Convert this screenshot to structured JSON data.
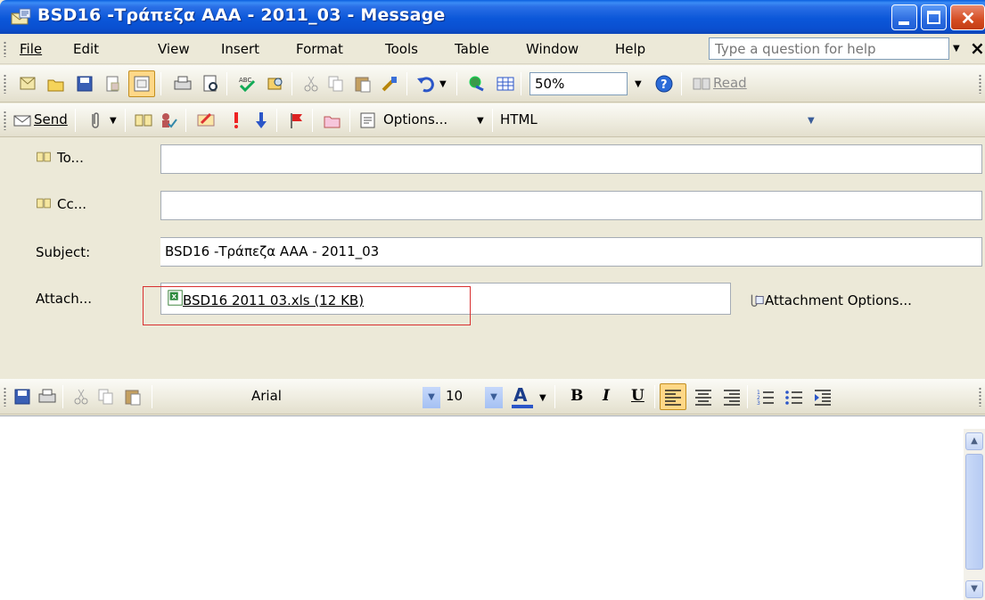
{
  "window": {
    "title": "BSD16 -Τράπεζα AAA - 2011_03 - Message"
  },
  "menu": {
    "items": [
      "File",
      "Edit",
      "View",
      "Insert",
      "Format",
      "Tools",
      "Table",
      "Window",
      "Help"
    ],
    "help_placeholder": "Type a question for help",
    "close_glyph": "×"
  },
  "standard_toolbar": {
    "zoom": "50%",
    "read_label": "Read"
  },
  "email_toolbar": {
    "send_label": "Send",
    "options_label": "Options...",
    "format": "HTML"
  },
  "header": {
    "to_label": "To...",
    "cc_label": "Cc...",
    "subject_label": "Subject:",
    "subject_value": "BSD16 -Τράπεζα AAA - 2011_03",
    "attach_label": "Attach...",
    "attachment_name": "BSD16 2011 03.xls (12 KB)",
    "attachment_options_label": "Attachment Options..."
  },
  "format_toolbar": {
    "font": "Arial",
    "size": "10"
  },
  "icons": [
    "outlook-icon",
    "minimize-icon",
    "maximize-icon",
    "close-icon",
    "new-icon",
    "open-icon",
    "save-icon",
    "print-icon",
    "spelling-icon",
    "cut-icon",
    "copy-icon",
    "paste-icon",
    "undo-icon",
    "table-icon",
    "help-icon",
    "paperclip-icon",
    "address-book-icon",
    "flag-icon",
    "bold-icon",
    "italic-icon",
    "underline-icon",
    "align-left-icon",
    "align-center-icon",
    "align-right-icon",
    "numbering-icon",
    "bullets-icon",
    "indent-icon"
  ]
}
